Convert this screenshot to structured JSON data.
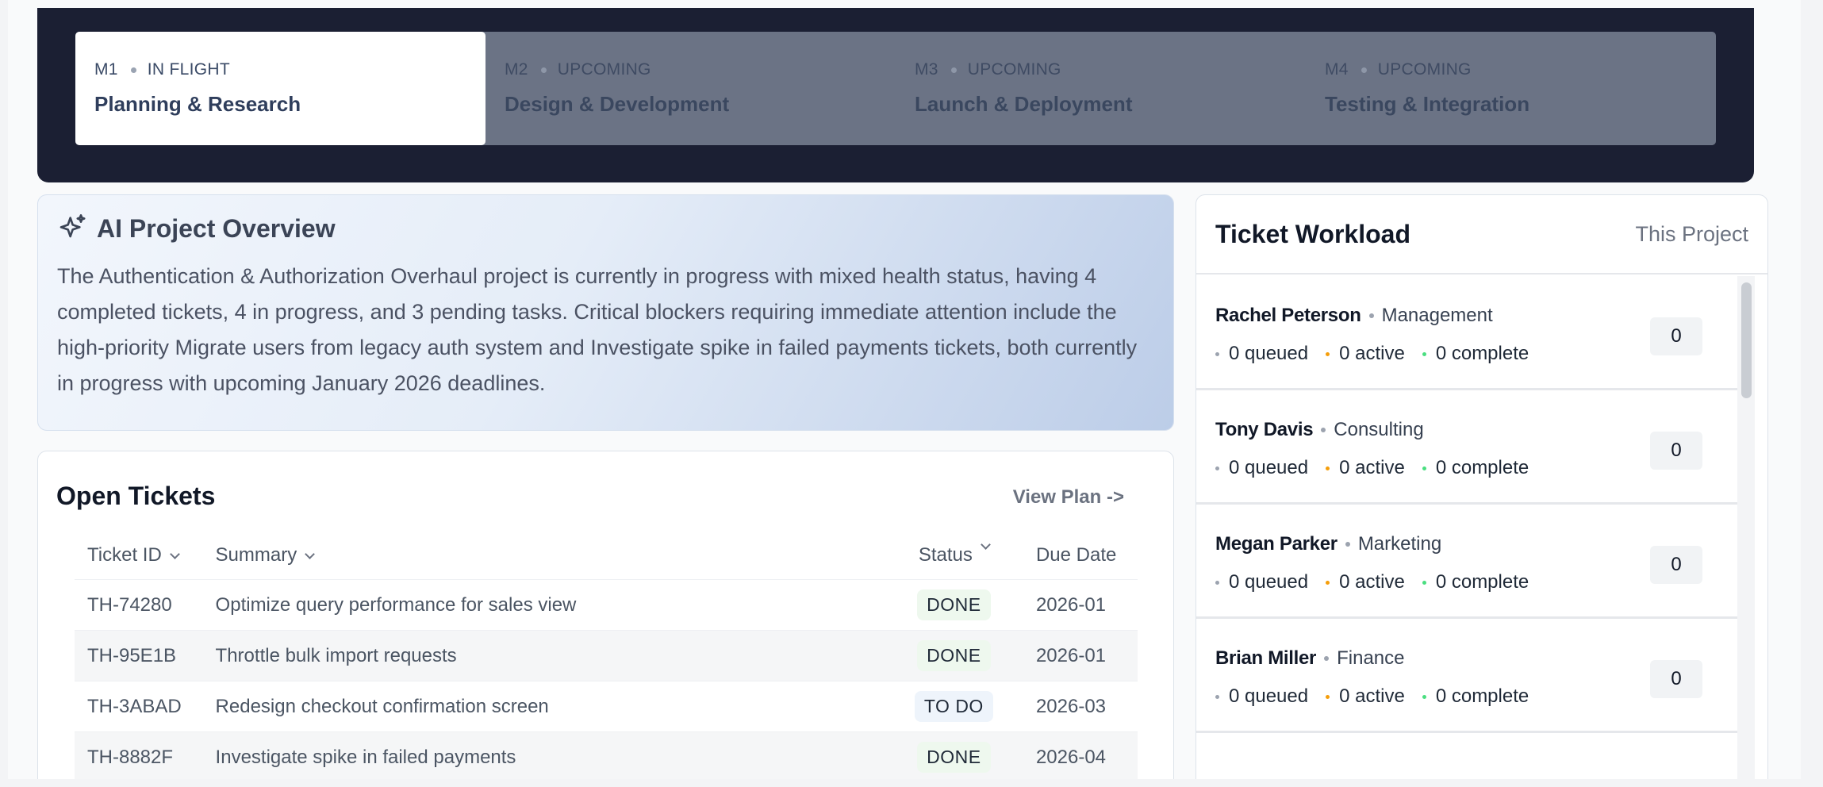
{
  "milestones": [
    {
      "code": "M1",
      "status": "IN FLIGHT",
      "title": "Planning & Research"
    },
    {
      "code": "M2",
      "status": "UPCOMING",
      "title": "Design & Development"
    },
    {
      "code": "M3",
      "status": "UPCOMING",
      "title": "Launch & Deployment"
    },
    {
      "code": "M4",
      "status": "UPCOMING",
      "title": "Testing & Integration"
    }
  ],
  "overview": {
    "icon": "sparkles-icon",
    "title": "AI Project Overview",
    "text": "The Authentication & Authorization Overhaul project is currently in progress with mixed health status, having 4 completed tickets, 4 in progress, and 3 pending tasks. Critical blockers requiring immediate attention include the high-priority Migrate users from legacy auth system and Investigate spike in failed payments tickets, both currently in progress with upcoming January 2026 deadlines."
  },
  "tickets": {
    "title": "Open Tickets",
    "view_plan": "View Plan ->",
    "columns": {
      "id": "Ticket ID",
      "summary": "Summary",
      "status": "Status",
      "due": "Due Date"
    },
    "rows": [
      {
        "id": "TH-74280",
        "summary": "Optimize query performance for sales view",
        "status": "DONE",
        "due": "2026-01"
      },
      {
        "id": "TH-95E1B",
        "summary": "Throttle bulk import requests",
        "status": "DONE",
        "due": "2026-01"
      },
      {
        "id": "TH-3ABAD",
        "summary": "Redesign checkout confirmation screen",
        "status": "TO DO",
        "due": "2026-03"
      },
      {
        "id": "TH-8882F",
        "summary": "Investigate spike in failed payments",
        "status": "DONE",
        "due": "2026-04"
      }
    ]
  },
  "workload": {
    "title": "Ticket Workload",
    "scope": "This Project",
    "people": [
      {
        "name": "Rachel Peterson",
        "dept": "Management",
        "queued": "0 queued",
        "active": "0 active",
        "complete": "0 complete",
        "count": "0"
      },
      {
        "name": "Tony Davis",
        "dept": "Consulting",
        "queued": "0 queued",
        "active": "0 active",
        "complete": "0 complete",
        "count": "0"
      },
      {
        "name": "Megan Parker",
        "dept": "Marketing",
        "queued": "0 queued",
        "active": "0 active",
        "complete": "0 complete",
        "count": "0"
      },
      {
        "name": "Brian Miller",
        "dept": "Finance",
        "queued": "0 queued",
        "active": "0 active",
        "complete": "0 complete",
        "count": "0"
      }
    ]
  }
}
